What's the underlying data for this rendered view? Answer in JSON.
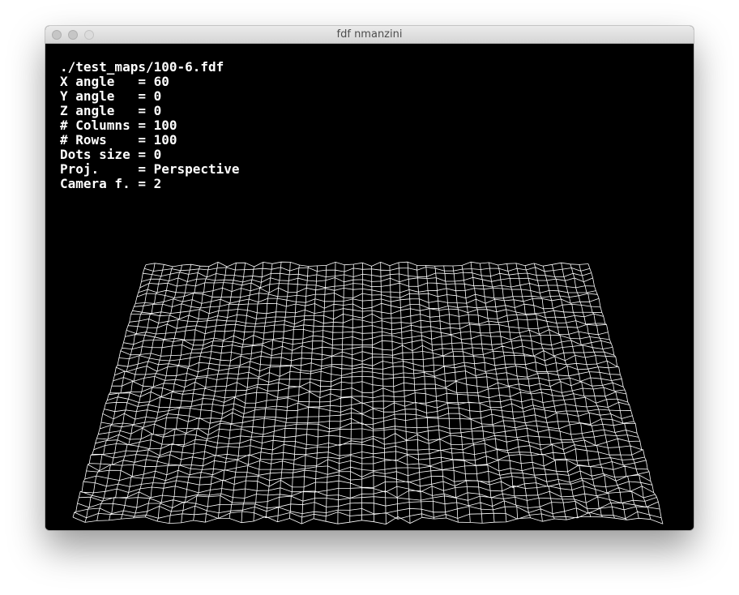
{
  "window": {
    "title": "fdf nmanzini"
  },
  "info": {
    "file": "./test_maps/100-6.fdf",
    "lines": [
      "X angle   = 60",
      "Y angle   = 0",
      "Z angle   = 0",
      "# Columns = 100",
      "# Rows    = 100",
      "Dots size = 0",
      "Proj.     = Perspective",
      "Camera f. = 2"
    ]
  },
  "map": {
    "columns": 100,
    "rows": 100,
    "x_angle": 60,
    "projection": "Perspective",
    "camera_focal": 2,
    "line_color": "#ffffff",
    "background_color": "#000000"
  }
}
